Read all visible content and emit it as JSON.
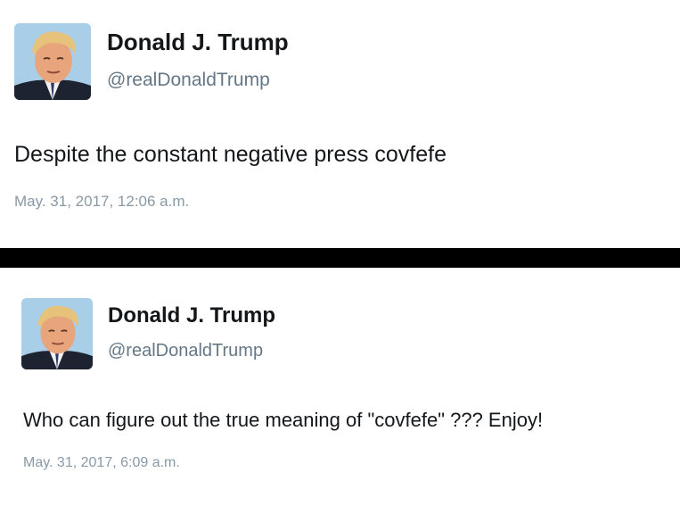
{
  "tweets": [
    {
      "display_name": "Donald J. Trump",
      "handle": "@realDonaldTrump",
      "text": "Despite the constant negative press covfefe",
      "timestamp": "May. 31, 2017, 12:06 a.m.",
      "avatar_icon": "profile-photo"
    },
    {
      "display_name": "Donald J. Trump",
      "handle": "@realDonaldTrump",
      "text": "Who can figure out the true meaning of \"covfefe\" ??? Enjoy!",
      "timestamp": "May. 31, 2017, 6:09 a.m.",
      "avatar_icon": "profile-photo"
    }
  ],
  "colors": {
    "name": "#14171a",
    "handle": "#657786",
    "timestamp": "#8899a6",
    "divider": "#000000",
    "avatar_bg": "#9ec8e6"
  }
}
